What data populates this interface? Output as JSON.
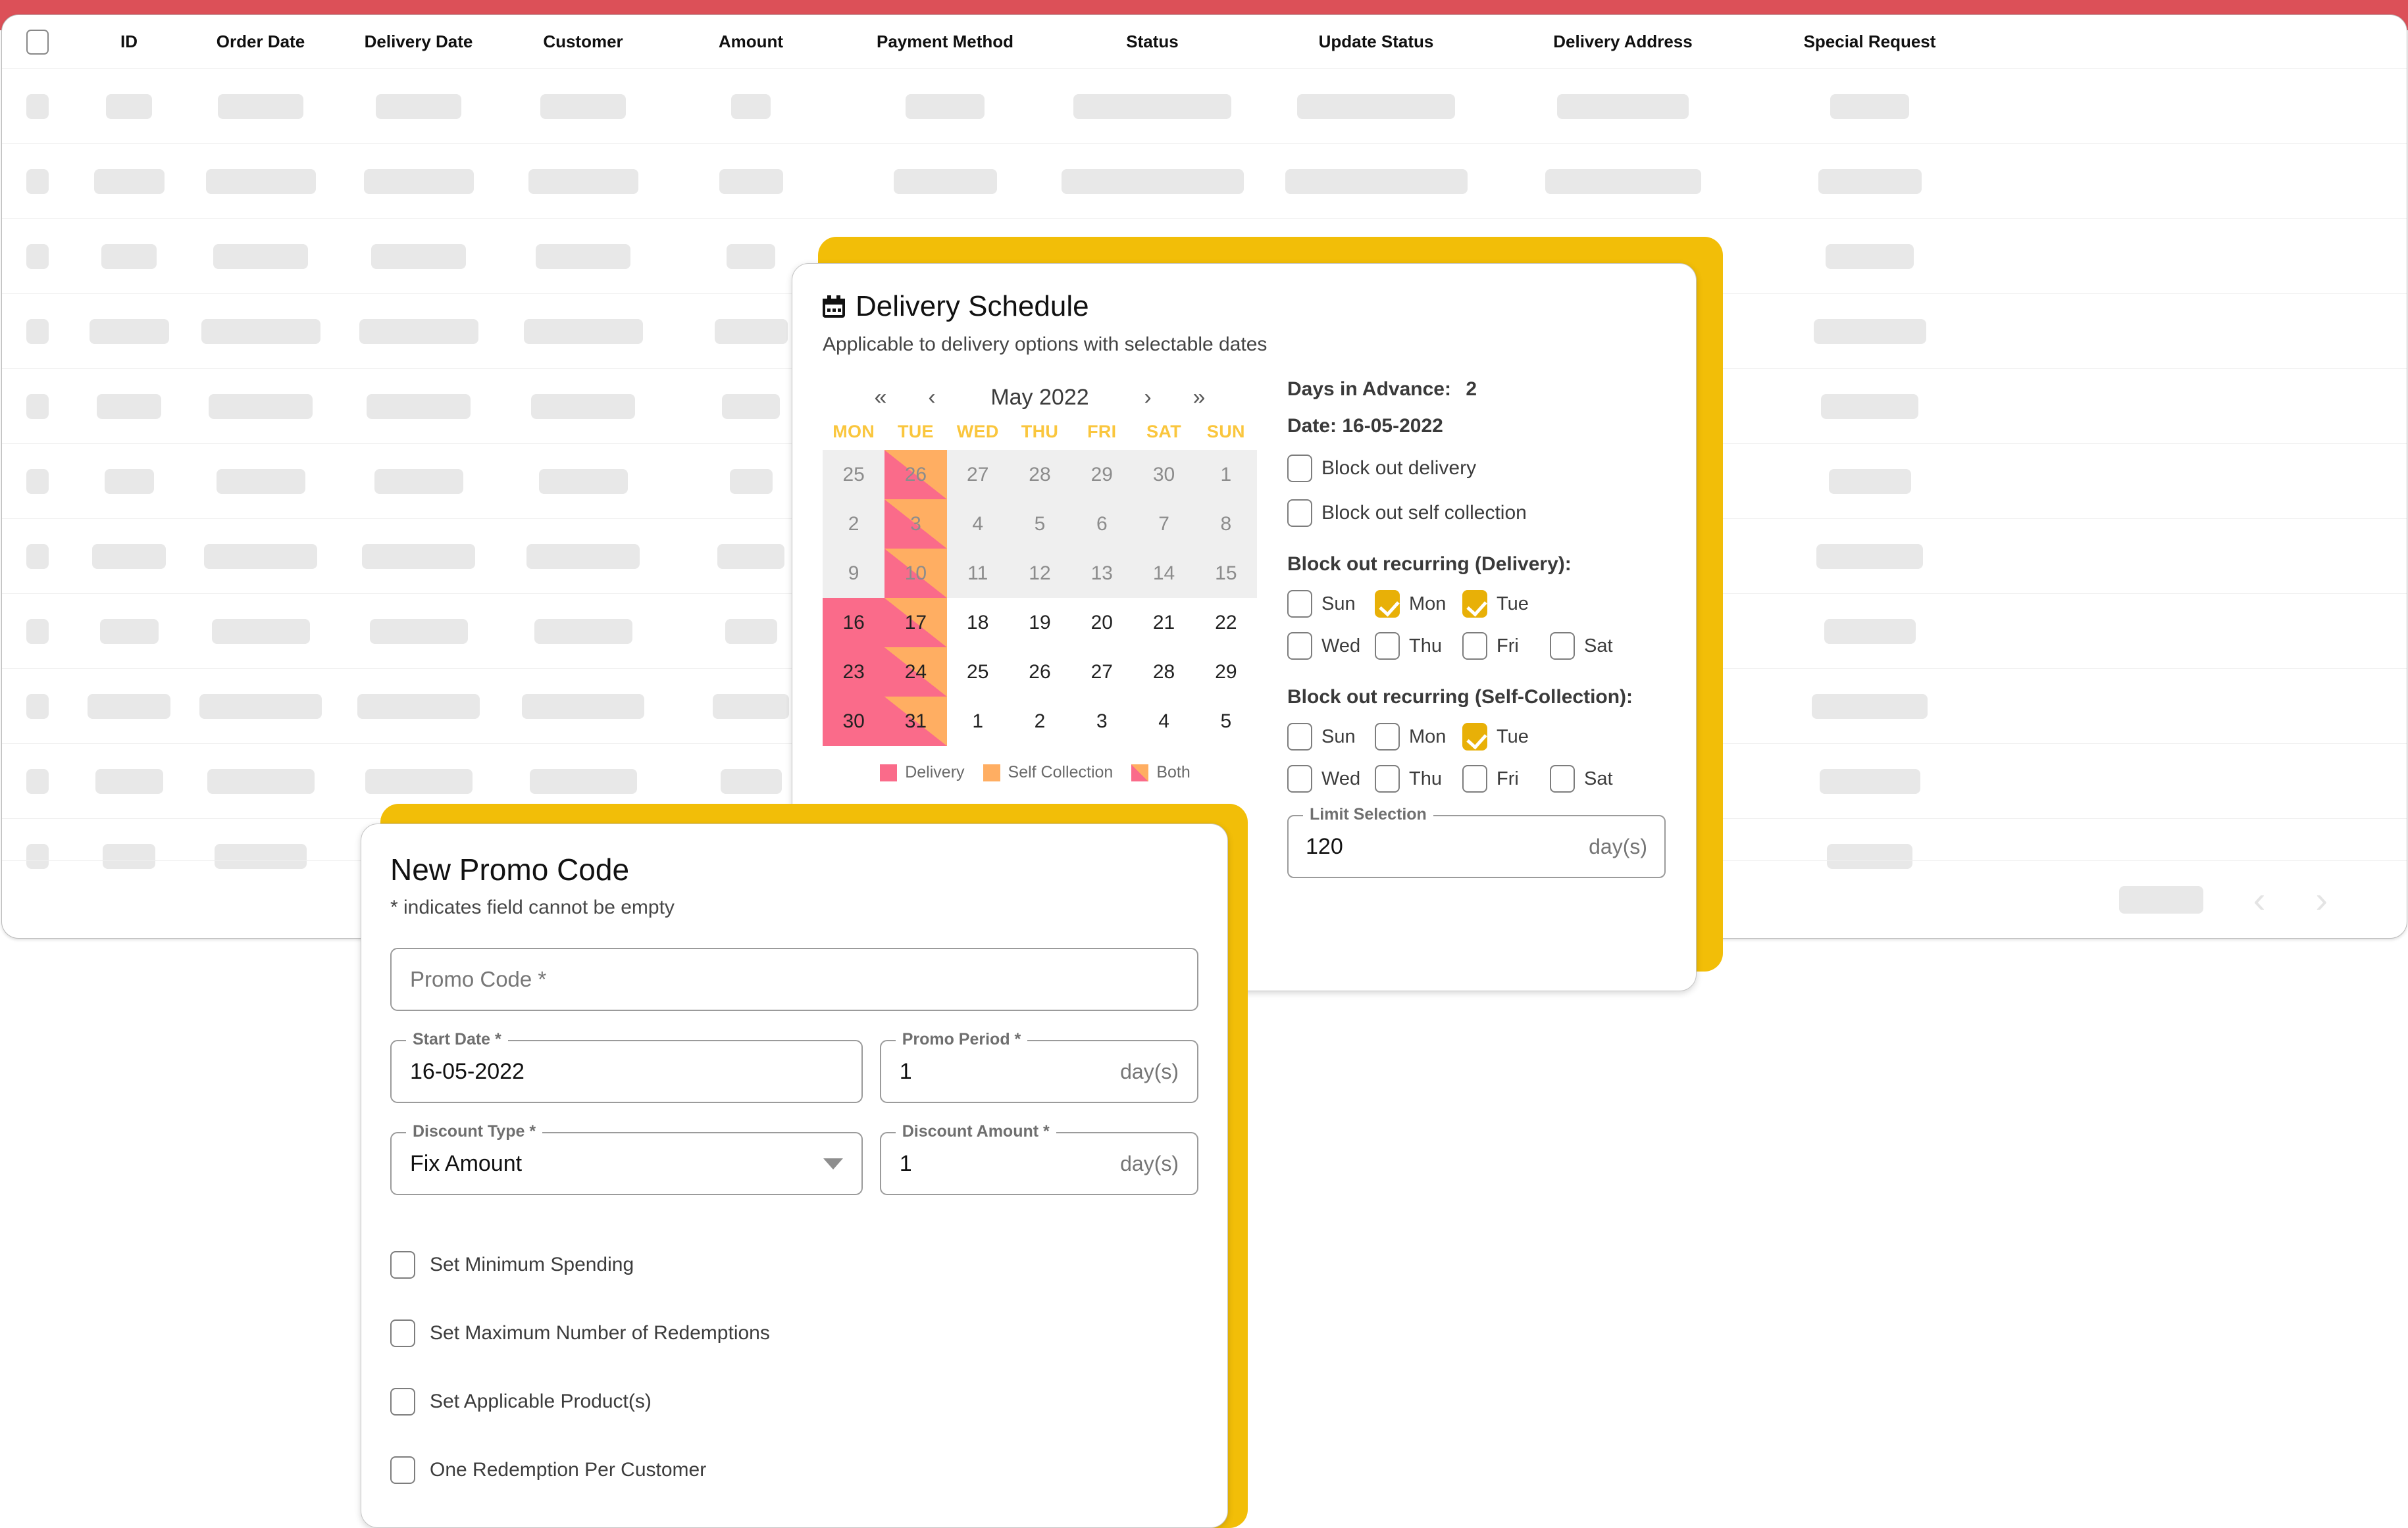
{
  "table": {
    "columns": [
      "ID",
      "Order Date",
      "Delivery Date",
      "Customer",
      "Amount",
      "Payment Method",
      "Status",
      "Update Status",
      "Delivery Address",
      "Special Request"
    ],
    "select_all_label": "",
    "pager": {
      "prev": "‹",
      "next": "›"
    },
    "row_count": 11
  },
  "delivery_schedule": {
    "title": "Delivery Schedule",
    "subtitle": "Applicable to delivery options with selectable dates",
    "calendar": {
      "nav": {
        "first": "«",
        "prev": "‹",
        "next": "›",
        "last": "»"
      },
      "month_label": "May 2022",
      "dow": [
        "MON",
        "TUE",
        "WED",
        "THU",
        "FRI",
        "SAT",
        "SUN"
      ],
      "weeks": [
        [
          {
            "d": "25",
            "state": "muted"
          },
          {
            "d": "26",
            "state": "muted both"
          },
          {
            "d": "27",
            "state": "muted"
          },
          {
            "d": "28",
            "state": "muted"
          },
          {
            "d": "29",
            "state": "muted"
          },
          {
            "d": "30",
            "state": "muted"
          },
          {
            "d": "1",
            "state": "muted"
          }
        ],
        [
          {
            "d": "2",
            "state": "muted"
          },
          {
            "d": "3",
            "state": "muted both"
          },
          {
            "d": "4",
            "state": "muted"
          },
          {
            "d": "5",
            "state": "muted"
          },
          {
            "d": "6",
            "state": "muted"
          },
          {
            "d": "7",
            "state": "muted"
          },
          {
            "d": "8",
            "state": "muted"
          }
        ],
        [
          {
            "d": "9",
            "state": "muted"
          },
          {
            "d": "10",
            "state": "muted both"
          },
          {
            "d": "11",
            "state": "muted"
          },
          {
            "d": "12",
            "state": "muted"
          },
          {
            "d": "13",
            "state": "muted"
          },
          {
            "d": "14",
            "state": "muted"
          },
          {
            "d": "15",
            "state": "muted"
          }
        ],
        [
          {
            "d": "16",
            "state": "deliv"
          },
          {
            "d": "17",
            "state": "both"
          },
          {
            "d": "18",
            "state": ""
          },
          {
            "d": "19",
            "state": ""
          },
          {
            "d": "20",
            "state": ""
          },
          {
            "d": "21",
            "state": ""
          },
          {
            "d": "22",
            "state": ""
          }
        ],
        [
          {
            "d": "23",
            "state": "deliv"
          },
          {
            "d": "24",
            "state": "both"
          },
          {
            "d": "25",
            "state": ""
          },
          {
            "d": "26",
            "state": ""
          },
          {
            "d": "27",
            "state": ""
          },
          {
            "d": "28",
            "state": ""
          },
          {
            "d": "29",
            "state": ""
          }
        ],
        [
          {
            "d": "30",
            "state": "deliv"
          },
          {
            "d": "31",
            "state": "both"
          },
          {
            "d": "1",
            "state": ""
          },
          {
            "d": "2",
            "state": ""
          },
          {
            "d": "3",
            "state": ""
          },
          {
            "d": "4",
            "state": ""
          },
          {
            "d": "5",
            "state": ""
          }
        ]
      ],
      "legend": [
        {
          "label": "Delivery",
          "swatch": "pink"
        },
        {
          "label": "Self Collection",
          "swatch": "orange"
        },
        {
          "label": "Both",
          "swatch": "both"
        }
      ]
    },
    "days_in_advance_label": "Days in Advance:",
    "days_in_advance_value": "2",
    "date_line": "Date: 16-05-2022",
    "block_delivery": {
      "label": "Block out delivery",
      "checked": false
    },
    "block_self_collection": {
      "label": "Block out self collection",
      "checked": false
    },
    "recurring_delivery": {
      "heading": "Block out recurring (Delivery):",
      "days": [
        {
          "label": "Sun",
          "checked": false
        },
        {
          "label": "Mon",
          "checked": true
        },
        {
          "label": "Tue",
          "checked": true
        },
        {
          "label": "Wed",
          "checked": false
        },
        {
          "label": "Thu",
          "checked": false
        },
        {
          "label": "Fri",
          "checked": false
        },
        {
          "label": "Sat",
          "checked": false
        }
      ]
    },
    "recurring_self_collection": {
      "heading": "Block out recurring (Self-Collection):",
      "days": [
        {
          "label": "Sun",
          "checked": false
        },
        {
          "label": "Mon",
          "checked": false
        },
        {
          "label": "Tue",
          "checked": true
        },
        {
          "label": "Wed",
          "checked": false
        },
        {
          "label": "Thu",
          "checked": false
        },
        {
          "label": "Fri",
          "checked": false
        },
        {
          "label": "Sat",
          "checked": false
        }
      ]
    },
    "limit_selection": {
      "label": "Limit Selection",
      "value": "120",
      "suffix": "day(s)"
    }
  },
  "promo_dialog": {
    "title": "New Promo Code",
    "subtitle": "* indicates field cannot be empty",
    "promo_code": {
      "placeholder": "Promo Code *",
      "value": ""
    },
    "start_date": {
      "label": "Start Date *",
      "value": "16-05-2022"
    },
    "promo_period": {
      "label": "Promo Period *",
      "value": "1",
      "suffix": "day(s)"
    },
    "discount_type": {
      "label": "Discount Type *",
      "value": "Fix Amount"
    },
    "discount_amount": {
      "label": "Discount Amount *",
      "value": "1",
      "suffix": "day(s)"
    },
    "options": [
      {
        "label": "Set Minimum Spending",
        "checked": false
      },
      {
        "label": "Set Maximum Number of Redemptions",
        "checked": false
      },
      {
        "label": "Set Applicable Product(s)",
        "checked": false
      },
      {
        "label": "One Redemption Per Customer",
        "checked": false
      }
    ]
  },
  "colors": {
    "topbar_red": "#DC5058",
    "accent_yellow": "#F2BE08",
    "checkbox_yellow": "#E8B007",
    "dow_yellow": "#FAC63D",
    "delivery_pink": "#FA6B8A",
    "self_collection_orange": "#FFAE62",
    "skeleton_gray": "#E8E8E8"
  }
}
